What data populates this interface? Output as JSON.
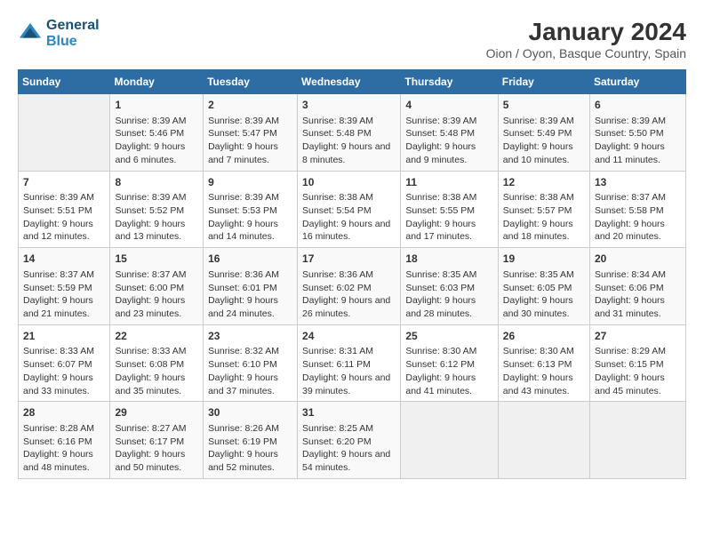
{
  "header": {
    "logo_line1": "General",
    "logo_line2": "Blue",
    "title": "January 2024",
    "subtitle": "Oion / Oyon, Basque Country, Spain"
  },
  "days_of_week": [
    "Sunday",
    "Monday",
    "Tuesday",
    "Wednesday",
    "Thursday",
    "Friday",
    "Saturday"
  ],
  "weeks": [
    [
      {
        "day": "",
        "sunrise": "",
        "sunset": "",
        "daylight": ""
      },
      {
        "day": "1",
        "sunrise": "Sunrise: 8:39 AM",
        "sunset": "Sunset: 5:46 PM",
        "daylight": "Daylight: 9 hours and 6 minutes."
      },
      {
        "day": "2",
        "sunrise": "Sunrise: 8:39 AM",
        "sunset": "Sunset: 5:47 PM",
        "daylight": "Daylight: 9 hours and 7 minutes."
      },
      {
        "day": "3",
        "sunrise": "Sunrise: 8:39 AM",
        "sunset": "Sunset: 5:48 PM",
        "daylight": "Daylight: 9 hours and 8 minutes."
      },
      {
        "day": "4",
        "sunrise": "Sunrise: 8:39 AM",
        "sunset": "Sunset: 5:48 PM",
        "daylight": "Daylight: 9 hours and 9 minutes."
      },
      {
        "day": "5",
        "sunrise": "Sunrise: 8:39 AM",
        "sunset": "Sunset: 5:49 PM",
        "daylight": "Daylight: 9 hours and 10 minutes."
      },
      {
        "day": "6",
        "sunrise": "Sunrise: 8:39 AM",
        "sunset": "Sunset: 5:50 PM",
        "daylight": "Daylight: 9 hours and 11 minutes."
      }
    ],
    [
      {
        "day": "7",
        "sunrise": "Sunrise: 8:39 AM",
        "sunset": "Sunset: 5:51 PM",
        "daylight": "Daylight: 9 hours and 12 minutes."
      },
      {
        "day": "8",
        "sunrise": "Sunrise: 8:39 AM",
        "sunset": "Sunset: 5:52 PM",
        "daylight": "Daylight: 9 hours and 13 minutes."
      },
      {
        "day": "9",
        "sunrise": "Sunrise: 8:39 AM",
        "sunset": "Sunset: 5:53 PM",
        "daylight": "Daylight: 9 hours and 14 minutes."
      },
      {
        "day": "10",
        "sunrise": "Sunrise: 8:38 AM",
        "sunset": "Sunset: 5:54 PM",
        "daylight": "Daylight: 9 hours and 16 minutes."
      },
      {
        "day": "11",
        "sunrise": "Sunrise: 8:38 AM",
        "sunset": "Sunset: 5:55 PM",
        "daylight": "Daylight: 9 hours and 17 minutes."
      },
      {
        "day": "12",
        "sunrise": "Sunrise: 8:38 AM",
        "sunset": "Sunset: 5:57 PM",
        "daylight": "Daylight: 9 hours and 18 minutes."
      },
      {
        "day": "13",
        "sunrise": "Sunrise: 8:37 AM",
        "sunset": "Sunset: 5:58 PM",
        "daylight": "Daylight: 9 hours and 20 minutes."
      }
    ],
    [
      {
        "day": "14",
        "sunrise": "Sunrise: 8:37 AM",
        "sunset": "Sunset: 5:59 PM",
        "daylight": "Daylight: 9 hours and 21 minutes."
      },
      {
        "day": "15",
        "sunrise": "Sunrise: 8:37 AM",
        "sunset": "Sunset: 6:00 PM",
        "daylight": "Daylight: 9 hours and 23 minutes."
      },
      {
        "day": "16",
        "sunrise": "Sunrise: 8:36 AM",
        "sunset": "Sunset: 6:01 PM",
        "daylight": "Daylight: 9 hours and 24 minutes."
      },
      {
        "day": "17",
        "sunrise": "Sunrise: 8:36 AM",
        "sunset": "Sunset: 6:02 PM",
        "daylight": "Daylight: 9 hours and 26 minutes."
      },
      {
        "day": "18",
        "sunrise": "Sunrise: 8:35 AM",
        "sunset": "Sunset: 6:03 PM",
        "daylight": "Daylight: 9 hours and 28 minutes."
      },
      {
        "day": "19",
        "sunrise": "Sunrise: 8:35 AM",
        "sunset": "Sunset: 6:05 PM",
        "daylight": "Daylight: 9 hours and 30 minutes."
      },
      {
        "day": "20",
        "sunrise": "Sunrise: 8:34 AM",
        "sunset": "Sunset: 6:06 PM",
        "daylight": "Daylight: 9 hours and 31 minutes."
      }
    ],
    [
      {
        "day": "21",
        "sunrise": "Sunrise: 8:33 AM",
        "sunset": "Sunset: 6:07 PM",
        "daylight": "Daylight: 9 hours and 33 minutes."
      },
      {
        "day": "22",
        "sunrise": "Sunrise: 8:33 AM",
        "sunset": "Sunset: 6:08 PM",
        "daylight": "Daylight: 9 hours and 35 minutes."
      },
      {
        "day": "23",
        "sunrise": "Sunrise: 8:32 AM",
        "sunset": "Sunset: 6:10 PM",
        "daylight": "Daylight: 9 hours and 37 minutes."
      },
      {
        "day": "24",
        "sunrise": "Sunrise: 8:31 AM",
        "sunset": "Sunset: 6:11 PM",
        "daylight": "Daylight: 9 hours and 39 minutes."
      },
      {
        "day": "25",
        "sunrise": "Sunrise: 8:30 AM",
        "sunset": "Sunset: 6:12 PM",
        "daylight": "Daylight: 9 hours and 41 minutes."
      },
      {
        "day": "26",
        "sunrise": "Sunrise: 8:30 AM",
        "sunset": "Sunset: 6:13 PM",
        "daylight": "Daylight: 9 hours and 43 minutes."
      },
      {
        "day": "27",
        "sunrise": "Sunrise: 8:29 AM",
        "sunset": "Sunset: 6:15 PM",
        "daylight": "Daylight: 9 hours and 45 minutes."
      }
    ],
    [
      {
        "day": "28",
        "sunrise": "Sunrise: 8:28 AM",
        "sunset": "Sunset: 6:16 PM",
        "daylight": "Daylight: 9 hours and 48 minutes."
      },
      {
        "day": "29",
        "sunrise": "Sunrise: 8:27 AM",
        "sunset": "Sunset: 6:17 PM",
        "daylight": "Daylight: 9 hours and 50 minutes."
      },
      {
        "day": "30",
        "sunrise": "Sunrise: 8:26 AM",
        "sunset": "Sunset: 6:19 PM",
        "daylight": "Daylight: 9 hours and 52 minutes."
      },
      {
        "day": "31",
        "sunrise": "Sunrise: 8:25 AM",
        "sunset": "Sunset: 6:20 PM",
        "daylight": "Daylight: 9 hours and 54 minutes."
      },
      {
        "day": "",
        "sunrise": "",
        "sunset": "",
        "daylight": ""
      },
      {
        "day": "",
        "sunrise": "",
        "sunset": "",
        "daylight": ""
      },
      {
        "day": "",
        "sunrise": "",
        "sunset": "",
        "daylight": ""
      }
    ]
  ]
}
